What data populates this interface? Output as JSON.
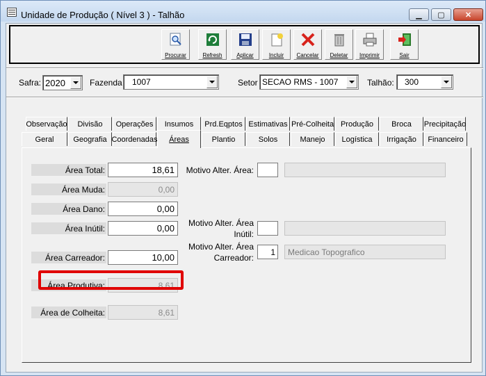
{
  "window": {
    "title": "Unidade de Produção ( Nível 3 ) - Talhão"
  },
  "toolbar": {
    "buttons": [
      {
        "label": "Procurar",
        "icon": "search-icon"
      },
      {
        "label": "Refresh",
        "icon": "refresh-icon"
      },
      {
        "label": "Aplicar",
        "icon": "save-icon"
      },
      {
        "label": "Incluir",
        "icon": "new-icon"
      },
      {
        "label": "Cancelar",
        "icon": "cancel-icon"
      },
      {
        "label": "Deletar",
        "icon": "trash-icon"
      },
      {
        "label": "Imprimir",
        "icon": "printer-icon"
      },
      {
        "label": "Sair",
        "icon": "exit-icon"
      }
    ]
  },
  "filters": {
    "safra_label": "Safra:",
    "safra_value": "2020",
    "fazenda_label": "Fazenda",
    "fazenda_value": "1007",
    "setor_label": "Setor",
    "setor_value": "SECAO RMS -   1007",
    "talhao_label": "Talhão:",
    "talhao_value": "300"
  },
  "tabs_row1": [
    "Observação",
    "Divisão",
    "Operações",
    "Insumos",
    "Prd.Eqptos",
    "Estimativas",
    "Pré-Colheita",
    "Produção",
    "Broca",
    "Precipitação"
  ],
  "tabs_row2": [
    "Geral",
    "Geografia",
    "Coordenadas",
    "Áreas",
    "Plantio",
    "Solos",
    "Manejo",
    "Logística",
    "Irrigação",
    "Financeiro"
  ],
  "active_tab": "Áreas",
  "areas": {
    "total_label": "Área Total:",
    "total_value": "18,61",
    "muda_label": "Área Muda:",
    "muda_value": "0,00",
    "dano_label": "Área Dano:",
    "dano_value": "0,00",
    "inutil_label": "Área Inútil:",
    "inutil_value": "0,00",
    "carreador_label": "Área Carreador:",
    "carreador_value": "10,00",
    "produtiva_label": "Área Produtiva:",
    "produtiva_value": "8,61",
    "colheita_label": "Área de Colheita:",
    "colheita_value": "8,61"
  },
  "motivos": {
    "area_label": "Motivo Alter. Área:",
    "inutil_label_1": "Motivo Alter. Área",
    "inutil_label_2": "Inútil:",
    "carreador_label_1": "Motivo Alter. Área",
    "carreador_label_2": "Carreador:",
    "carreador_code": "1",
    "carreador_desc": "Medicao Topografico"
  },
  "colors": {
    "highlight": "#e00000",
    "titlebar": "#c4d8ef"
  }
}
